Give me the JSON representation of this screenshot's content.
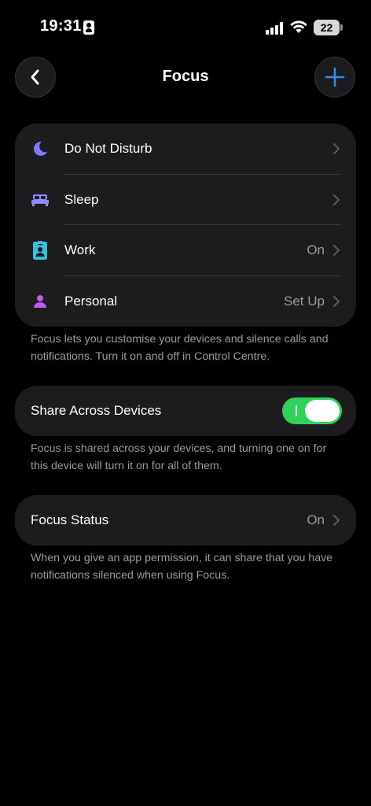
{
  "status_bar": {
    "time": "19:31",
    "battery": "22"
  },
  "nav": {
    "title": "Focus"
  },
  "focus_modes": [
    {
      "label": "Do Not Disturb",
      "value": "",
      "icon": "moon-icon",
      "color": "#7d7aff"
    },
    {
      "label": "Sleep",
      "value": "",
      "icon": "bed-icon",
      "color": "#8e8cff"
    },
    {
      "label": "Work",
      "value": "On",
      "icon": "id-badge-icon",
      "color": "#36c0e0"
    },
    {
      "label": "Personal",
      "value": "Set Up",
      "icon": "person-icon",
      "color": "#bf5af2"
    }
  ],
  "focus_note": "Focus lets you customise your devices and silence calls and notifications. Turn it on and off in Control Centre.",
  "share": {
    "label": "Share Across Devices",
    "enabled": true,
    "note": "Focus is shared across your devices, and turning one on for this device will turn it on for all of them."
  },
  "status": {
    "label": "Focus Status",
    "value": "On",
    "note": "When you give an app permission, it can share that you have notifications silenced when using Focus."
  },
  "colors": {
    "accent": "#2f8ef4",
    "toggle_on": "#30d158",
    "group_bg": "#1c1c1e"
  }
}
